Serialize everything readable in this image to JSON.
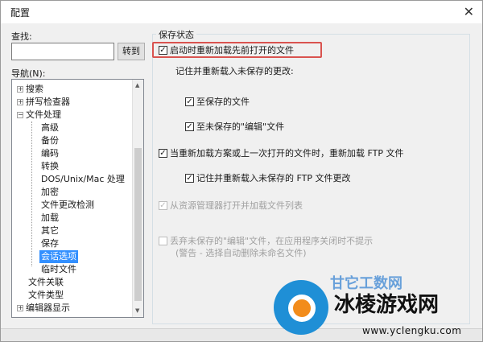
{
  "window": {
    "title": "配置",
    "close_glyph": "✕"
  },
  "search": {
    "label": "查找:",
    "value": "",
    "goto_label": "转到"
  },
  "nav": {
    "label": "导航(N):",
    "items": [
      {
        "label": "搜索",
        "expander": "+"
      },
      {
        "label": "拼写检查器",
        "expander": "+"
      },
      {
        "label": "文件处理",
        "expander": "−"
      },
      {
        "label": "高级"
      },
      {
        "label": "备份"
      },
      {
        "label": "编码"
      },
      {
        "label": "转换"
      },
      {
        "label": "DOS/Unix/Mac 处理"
      },
      {
        "label": "加密"
      },
      {
        "label": "文件更改检测"
      },
      {
        "label": "加载"
      },
      {
        "label": "其它"
      },
      {
        "label": "保存"
      },
      {
        "label": "会话选项",
        "selected": true
      },
      {
        "label": "临时文件"
      },
      {
        "label": "文件关联"
      },
      {
        "label": "文件类型"
      },
      {
        "label": "编辑器显示",
        "expander": "+"
      }
    ]
  },
  "group": {
    "title": "保存状态"
  },
  "options": {
    "reopen_files": {
      "label": "启动时重新加载先前打开的文件",
      "checked": true
    },
    "remember_label": "记住并重新载入未保存的更改:",
    "to_saved": {
      "label": "至保存的文件",
      "checked": true
    },
    "to_unsaved": {
      "label": "至未保存的\"编辑\"文件",
      "checked": true
    },
    "ftp_reload": {
      "label": "当重新加载方案或上一次打开的文件时，重新加载 FTP 文件",
      "checked": true
    },
    "ftp_remember": {
      "label": "记住并重新载入未保存的 FTP 文件更改",
      "checked": true
    },
    "explorer_reload": {
      "label": "从资源管理器打开并加载文件列表",
      "checked": true,
      "disabled": true
    },
    "discard_unsaved": {
      "label": "丢弃未保存的\"编辑\"文件，在应用程序关闭时不提示",
      "checked": false,
      "disabled": true
    },
    "discard_note": "(警告 - 选择自动删除未命名文件)"
  },
  "watermark": {
    "text": "冰棱游戏网",
    "url": "www.yclengku.com",
    "partial_top": "甘它工数网"
  },
  "colors": {
    "highlight": "#d9534f",
    "selection": "#3390ff"
  }
}
